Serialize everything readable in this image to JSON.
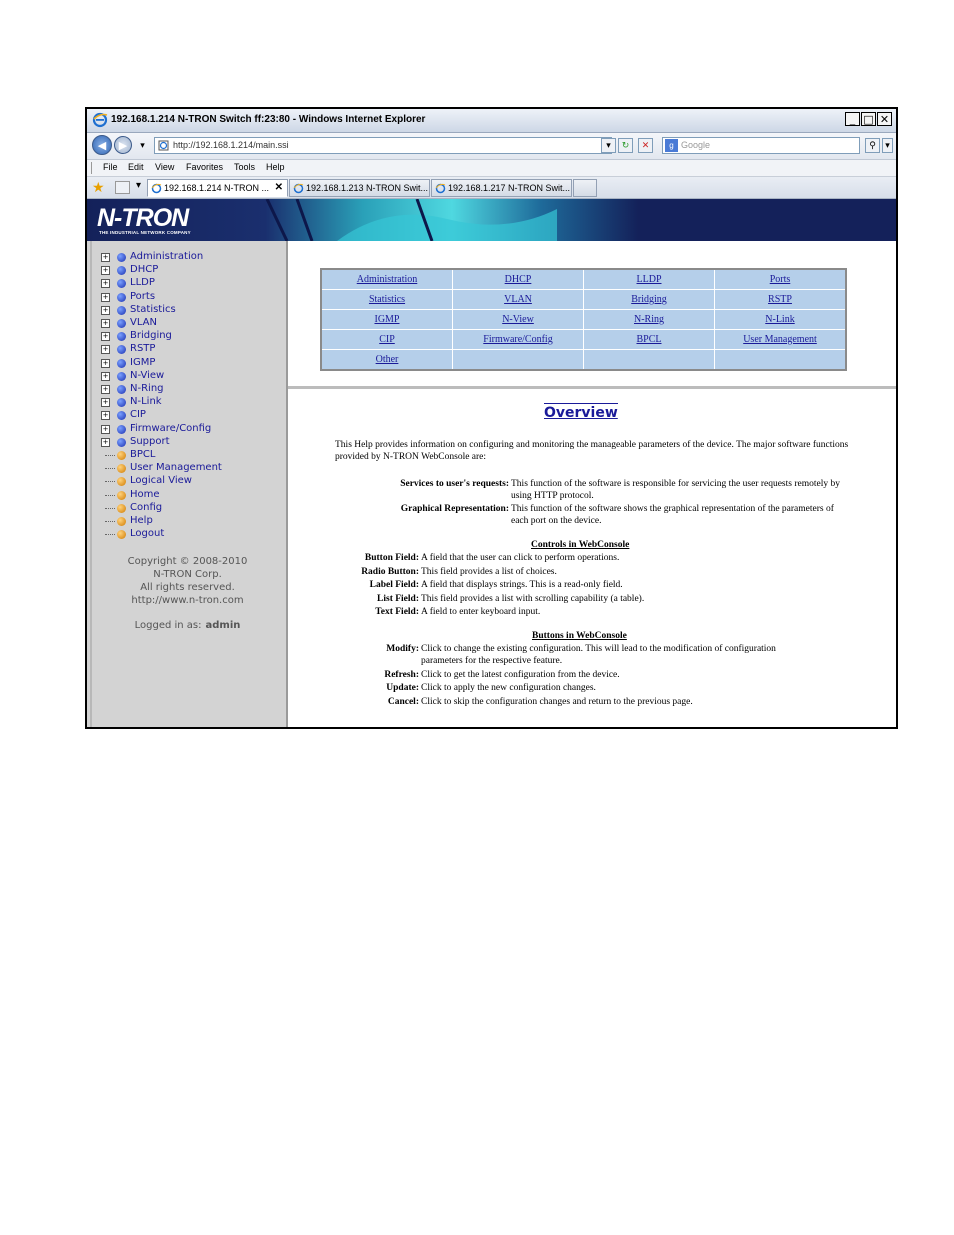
{
  "window": {
    "title": "192.168.1.214 N-TRON Switch ff:23:80 - Windows Internet Explorer",
    "controls": [
      "_",
      "□",
      "✕"
    ]
  },
  "address": {
    "url": "http://192.168.1.214/main.ssi",
    "search_placeholder": "Google"
  },
  "menu": [
    "File",
    "Edit",
    "View",
    "Favorites",
    "Tools",
    "Help"
  ],
  "tabs": [
    {
      "label": "192.168.1.214 N-TRON ...",
      "active": true
    },
    {
      "label": "192.168.1.213 N-TRON Swit...",
      "active": false
    },
    {
      "label": "192.168.1.217 N-TRON Swit...",
      "active": false
    }
  ],
  "banner": {
    "logo": "N-TRON",
    "tagline": "THE INDUSTRIAL NETWORK COMPANY"
  },
  "sidebar": {
    "items": [
      {
        "label": "Administration",
        "expandable": true
      },
      {
        "label": "DHCP",
        "expandable": true
      },
      {
        "label": "LLDP",
        "expandable": true
      },
      {
        "label": "Ports",
        "expandable": true
      },
      {
        "label": "Statistics",
        "expandable": true
      },
      {
        "label": "VLAN",
        "expandable": true
      },
      {
        "label": "Bridging",
        "expandable": true
      },
      {
        "label": "RSTP",
        "expandable": true
      },
      {
        "label": "IGMP",
        "expandable": true
      },
      {
        "label": "N-View",
        "expandable": true
      },
      {
        "label": "N-Ring",
        "expandable": true
      },
      {
        "label": "N-Link",
        "expandable": true
      },
      {
        "label": "CIP",
        "expandable": true
      },
      {
        "label": "Firmware/Config",
        "expandable": true
      },
      {
        "label": "Support",
        "expandable": true
      },
      {
        "label": "BPCL",
        "expandable": false
      },
      {
        "label": "User Management",
        "expandable": false
      },
      {
        "label": "Logical View",
        "expandable": false
      },
      {
        "label": "Home",
        "expandable": false
      },
      {
        "label": "Config",
        "expandable": false
      },
      {
        "label": "Help",
        "expandable": false
      },
      {
        "label": "Logout",
        "expandable": false
      }
    ],
    "copyright": [
      "Copyright © 2008-2010",
      "N-TRON Corp.",
      "All rights reserved.",
      "http://www.n-tron.com"
    ],
    "logged_in_label": "Logged in as:",
    "logged_in_user": "admin"
  },
  "links": [
    [
      "Administration",
      "DHCP",
      "LLDP",
      "Ports"
    ],
    [
      "Statistics",
      "VLAN",
      "Bridging",
      "RSTP"
    ],
    [
      "IGMP",
      "N-View",
      "N-Ring",
      "N-Link"
    ],
    [
      "CIP",
      "Firmware/Config",
      "BPCL",
      "User Management"
    ],
    [
      "Other",
      "",
      "",
      ""
    ]
  ],
  "help": {
    "title": "Overview",
    "intro": "This Help provides information on configuring and monitoring the manageable parameters of the device. The major software functions provided by N-TRON WebConsole are:",
    "functions": [
      {
        "label": "Services to user's requests:",
        "text": "This function of the software is responsible for servicing the user requests remotely by using HTTP protocol."
      },
      {
        "label": "Graphical Representation:",
        "text": "This function of the software shows the graphical representation of the parameters of each port on the device."
      }
    ],
    "controls_heading": "Controls in WebConsole",
    "controls": [
      {
        "label": "Button Field:",
        "text": "A field that the user can click to perform operations."
      },
      {
        "label": "Radio Button:",
        "text": "This field provides a list of choices."
      },
      {
        "label": "Label Field:",
        "text": "A field that displays strings. This is a read-only field."
      },
      {
        "label": "List Field:",
        "text": "This field provides a list with scrolling capability (a table)."
      },
      {
        "label": "Text Field:",
        "text": "A field to enter keyboard input."
      }
    ],
    "buttons_heading": "Buttons in WebConsole",
    "buttons": [
      {
        "label": "Modify:",
        "text": "Click to change the existing configuration. This will lead to the modification of configuration parameters for the respective feature."
      },
      {
        "label": "Refresh:",
        "text": "Click to get the latest configuration from the device."
      },
      {
        "label": "Update:",
        "text": "Click to apply the new configuration changes."
      },
      {
        "label": "Cancel:",
        "text": "Click to skip the configuration changes and return to the previous page."
      }
    ]
  },
  "colors": {
    "banner": "#14215a",
    "link_cell": "#b5cfea",
    "link_text": "#1a1a99",
    "sidebar": "#d3d3d3"
  }
}
